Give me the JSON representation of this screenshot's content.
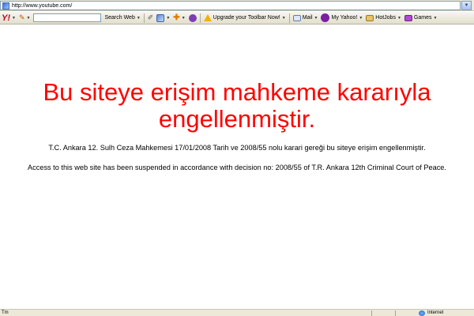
{
  "address_bar": {
    "url": "http://www.youtube.com/"
  },
  "toolbar": {
    "logo": "Y!",
    "search_label": "Search Web",
    "upgrade_label": "Upgrade your Toolbar Now!",
    "mail_label": "Mail",
    "my_yahoo_label": "My Yahoo!",
    "hotjobs_label": "HotJobs",
    "games_label": "Games"
  },
  "message": {
    "heading_line1": "Bu siteye erişim mahkeme kararıyla",
    "heading_line2": "engellenmiştir.",
    "turkish_text": "T.C. Ankara 12. Sulh Ceza Mahkemesi 17/01/2008 Tarih ve 2008/55 nolu karari gereği bu siteye erişim engellenmiştir.",
    "english_text": "Access to this web site has been suspended in accordance with decision no: 2008/55 of T.R. Ankara 12th Criminal Court of Peace."
  },
  "status_bar": {
    "left_text": "Tm",
    "zone_label": "Internet"
  },
  "colors": {
    "heading": "#ff0000",
    "yahoo_logo": "#c4001f"
  }
}
